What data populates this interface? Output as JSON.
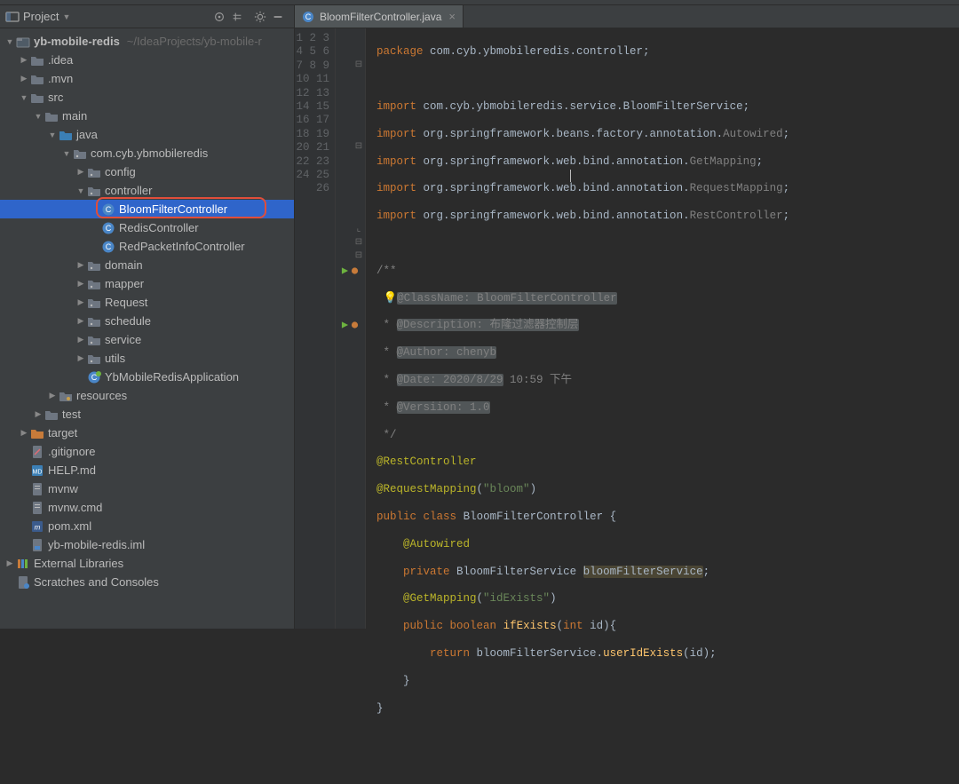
{
  "sidebar": {
    "title": "Project",
    "projectRoot": {
      "name": "yb-mobile-redis",
      "path": "~/IdeaProjects/yb-mobile-r"
    },
    "nodes": [
      {
        "depth": 1,
        "arrow": "down",
        "icon": "module",
        "label": "yb-mobile-redis",
        "bold": true,
        "extra": "~/IdeaProjects/yb-mobile-r"
      },
      {
        "depth": 2,
        "arrow": "right",
        "icon": "folder",
        "label": ".idea"
      },
      {
        "depth": 2,
        "arrow": "right",
        "icon": "folder",
        "label": ".mvn"
      },
      {
        "depth": 2,
        "arrow": "down",
        "icon": "folder",
        "label": "src"
      },
      {
        "depth": 3,
        "arrow": "down",
        "icon": "folder",
        "label": "main"
      },
      {
        "depth": 4,
        "arrow": "down",
        "icon": "folder-src",
        "label": "java"
      },
      {
        "depth": 5,
        "arrow": "down",
        "icon": "package",
        "label": "com.cyb.ybmobileredis"
      },
      {
        "depth": 6,
        "arrow": "right",
        "icon": "package",
        "label": "config"
      },
      {
        "depth": 6,
        "arrow": "down",
        "icon": "package",
        "label": "controller"
      },
      {
        "depth": 7,
        "arrow": "none",
        "icon": "class",
        "label": "BloomFilterController",
        "selected": true
      },
      {
        "depth": 7,
        "arrow": "none",
        "icon": "class",
        "label": "RedisController"
      },
      {
        "depth": 7,
        "arrow": "none",
        "icon": "class",
        "label": "RedPacketInfoController"
      },
      {
        "depth": 6,
        "arrow": "right",
        "icon": "package",
        "label": "domain"
      },
      {
        "depth": 6,
        "arrow": "right",
        "icon": "package",
        "label": "mapper"
      },
      {
        "depth": 6,
        "arrow": "right",
        "icon": "package",
        "label": "Request"
      },
      {
        "depth": 6,
        "arrow": "right",
        "icon": "package",
        "label": "schedule"
      },
      {
        "depth": 6,
        "arrow": "right",
        "icon": "package",
        "label": "service"
      },
      {
        "depth": 6,
        "arrow": "right",
        "icon": "package",
        "label": "utils"
      },
      {
        "depth": 6,
        "arrow": "none",
        "icon": "spring-class",
        "label": "YbMobileRedisApplication"
      },
      {
        "depth": 4,
        "arrow": "right",
        "icon": "folder-res",
        "label": "resources"
      },
      {
        "depth": 3,
        "arrow": "right",
        "icon": "folder",
        "label": "test"
      },
      {
        "depth": 2,
        "arrow": "right",
        "icon": "folder-target",
        "label": "target"
      },
      {
        "depth": 2,
        "arrow": "none",
        "icon": "gitignore",
        "label": ".gitignore"
      },
      {
        "depth": 2,
        "arrow": "none",
        "icon": "md",
        "label": "HELP.md"
      },
      {
        "depth": 2,
        "arrow": "none",
        "icon": "file",
        "label": "mvnw"
      },
      {
        "depth": 2,
        "arrow": "none",
        "icon": "file",
        "label": "mvnw.cmd"
      },
      {
        "depth": 2,
        "arrow": "none",
        "icon": "maven",
        "label": "pom.xml"
      },
      {
        "depth": 2,
        "arrow": "none",
        "icon": "iml",
        "label": "yb-mobile-redis.iml"
      },
      {
        "depth": 1,
        "arrow": "right",
        "icon": "lib",
        "label": "External Libraries"
      },
      {
        "depth": 1,
        "arrow": "none",
        "icon": "scratch",
        "label": "Scratches and Consoles"
      }
    ]
  },
  "editor": {
    "tab": {
      "label": "BloomFilterController.java",
      "icon": "class"
    },
    "lineCount": 26,
    "code": {
      "l1": {
        "kw": "package",
        "rest": " com.cyb.ybmobileredis.controller;"
      },
      "l3": {
        "kw": "import",
        "pkg": " com.cyb.ybmobileredis.service.",
        "cls": "BloomFilterService",
        "end": ";"
      },
      "l4": {
        "kw": "import",
        "pkg": " org.springframework.beans.factory.annotation.",
        "gray": "Autowired",
        "end": ";"
      },
      "l5": {
        "kw": "import",
        "pkg": " org.springframework.web.bind.annotation.",
        "gray": "GetMapping",
        "end": ";"
      },
      "l6": {
        "kw": "import",
        "pkg": " org.springframework.web.bind.annotation.",
        "gray": "RequestMapping",
        "end": ";"
      },
      "l7": {
        "kw": "import",
        "pkg": " org.springframework.web.bind.annotation.",
        "gray": "RestController",
        "end": ";"
      },
      "l9": {
        "text": "/**"
      },
      "l10": {
        "bulb": "💡",
        "text": "@ClassName: BloomFilterController"
      },
      "l11": {
        "pre": " * ",
        "text": "@Description: 布隆过滤器控制层"
      },
      "l12": {
        "pre": " * ",
        "text": "@Author: chenyb"
      },
      "l13": {
        "pre": " * ",
        "text1": "@Date: 2020/8/29",
        "text2": " 10:59 下午"
      },
      "l14": {
        "pre": " * ",
        "text": "@Versiion: 1.0"
      },
      "l15": {
        "text": " */"
      },
      "l16": {
        "ann": "@RestController"
      },
      "l17": {
        "ann1": "@RequestMapping",
        "paren": "(",
        "str": "\"bloom\"",
        "paren2": ")"
      },
      "l18": {
        "kw1": "public",
        "kw2": "class",
        "name": "BloomFilterController",
        "brace": " {"
      },
      "l19": {
        "ann": "@Autowired"
      },
      "l20": {
        "kw": "private",
        "type": "BloomFilterService",
        "field": "bloomFilterService",
        "end": ";"
      },
      "l21": {
        "ann1": "@GetMapping",
        "paren": "(",
        "str": "\"idExists\"",
        "paren2": ")"
      },
      "l22": {
        "kw1": "public",
        "kw2": "boolean",
        "name": "ifExists",
        "sig1": "(",
        "kw3": "int",
        "sig2": " id){"
      },
      "l23": {
        "kw": "return",
        "obj": " bloomFilterService.",
        "call": "userIdExists",
        "args": "(id);"
      },
      "l24": {
        "text": "    }"
      },
      "l25": {
        "text": "}"
      }
    }
  }
}
